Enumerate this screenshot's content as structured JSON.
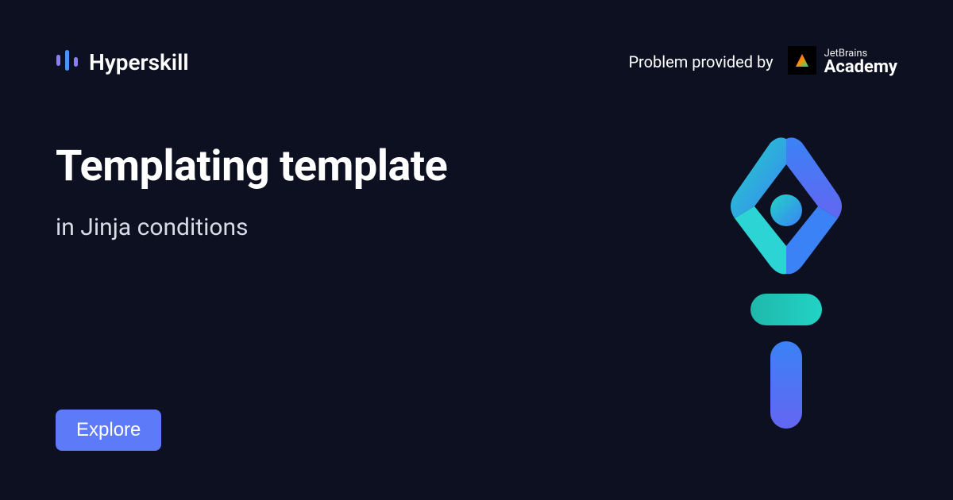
{
  "header": {
    "brand_name": "Hyperskill",
    "provider_label": "Problem provided by",
    "academy_top": "JetBrains",
    "academy_bottom": "Academy"
  },
  "main": {
    "title": "Templating template",
    "subtitle": "in Jinja conditions"
  },
  "cta": {
    "explore_label": "Explore"
  },
  "colors": {
    "background": "#0d1020",
    "accent": "#5d7bf9",
    "teal": "#22d3c5",
    "blue": "#3b82f6",
    "purple": "#6366f1"
  }
}
